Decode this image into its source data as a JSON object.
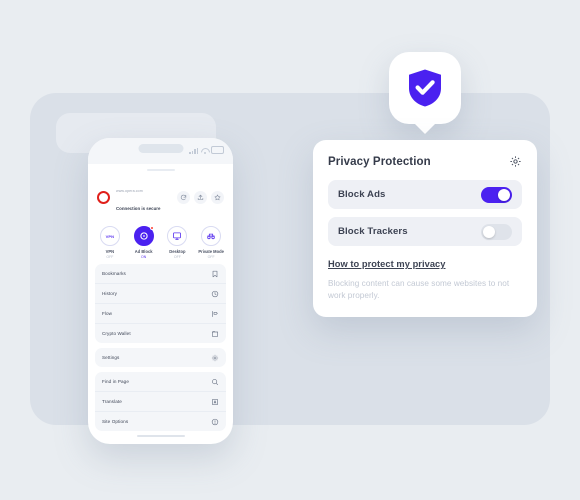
{
  "background": {
    "page_color": "#e9edf1",
    "window_panel_color": "#dae0e8",
    "window_bar_color": "#e6eaf0"
  },
  "badge": {
    "icon": "shield-check-icon",
    "shield_color": "#4b21f0",
    "check_color": "#ffffff"
  },
  "phone": {
    "status_bar": {
      "signal_icon": "signal-bars-icon",
      "wifi_icon": "wifi-icon",
      "battery_icon": "battery-icon"
    },
    "url_bar": {
      "brand_icon": "opera-logo-icon",
      "brand_color": "#e0201b",
      "url": "www.opera.com",
      "security_text": "Connection is secure",
      "actions": [
        {
          "name": "reload-button",
          "icon": "reload-icon"
        },
        {
          "name": "share-button",
          "icon": "share-icon"
        },
        {
          "name": "bookmark-star-button",
          "icon": "star-icon"
        }
      ]
    },
    "quick_toggles": [
      {
        "label": "VPN",
        "status": "OFF",
        "active": false,
        "icon": "vpn-icon"
      },
      {
        "label": "Ad Block",
        "status": "ON",
        "active": true,
        "icon": "ad-block-icon",
        "badge_dot": true
      },
      {
        "label": "Desktop",
        "status": "OFF",
        "active": false,
        "icon": "desktop-icon"
      },
      {
        "label": "Private Mode",
        "status": "OFF",
        "active": false,
        "icon": "private-mode-icon"
      }
    ],
    "menu_groups": [
      {
        "items": [
          {
            "label": "Bookmarks",
            "icon": "bookmark-icon"
          },
          {
            "label": "History",
            "icon": "clock-icon"
          },
          {
            "label": "Flow",
            "icon": "flow-icon"
          },
          {
            "label": "Crypto Wallet",
            "icon": "wallet-icon"
          }
        ]
      },
      {
        "items": [
          {
            "label": "Settings",
            "icon": "gear-icon"
          }
        ]
      },
      {
        "items": [
          {
            "label": "Find in Page",
            "icon": "search-icon"
          },
          {
            "label": "Translate",
            "icon": "translate-icon"
          },
          {
            "label": "Site Options",
            "icon": "info-icon"
          }
        ]
      }
    ]
  },
  "privacy_popover": {
    "title": "Privacy Protection",
    "settings_icon": "gear-icon",
    "rows": [
      {
        "label": "Block Ads",
        "enabled": true
      },
      {
        "label": "Block Trackers",
        "enabled": false
      }
    ],
    "link_text": "How to protect my privacy",
    "helper_text": "Blocking content can cause some websites to not work properly.",
    "accent_color": "#4b21f0",
    "row_bg_color": "#eef0f5"
  }
}
